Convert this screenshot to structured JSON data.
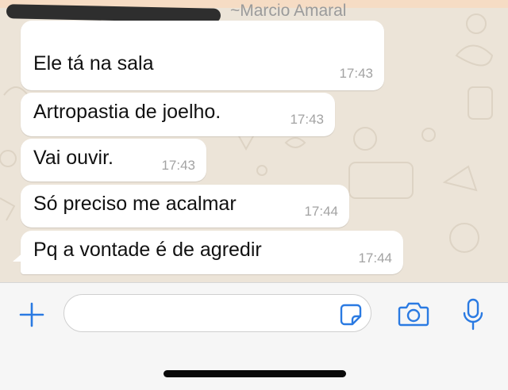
{
  "chat": {
    "sender_name": "~Marcio Amaral",
    "messages": [
      {
        "text": "Ele tá na sala",
        "time": "17:43"
      },
      {
        "text": "Artropastia de joelho.",
        "time": "17:43"
      },
      {
        "text": "Vai ouvir.",
        "time": "17:43"
      },
      {
        "text": "Só preciso me acalmar",
        "time": "17:44"
      },
      {
        "text": "Pq a vontade é de agredir",
        "time": "17:44"
      }
    ]
  },
  "input_bar": {
    "message_value": "",
    "icons": {
      "add": "plus-icon",
      "sticker": "sticker-icon",
      "camera": "camera-icon",
      "mic": "microphone-icon"
    }
  },
  "colors": {
    "accent": "#2a7ae2",
    "chat_background": "#ece4d8",
    "bubble": "#ffffff",
    "timestamp": "#a3a3a3"
  }
}
